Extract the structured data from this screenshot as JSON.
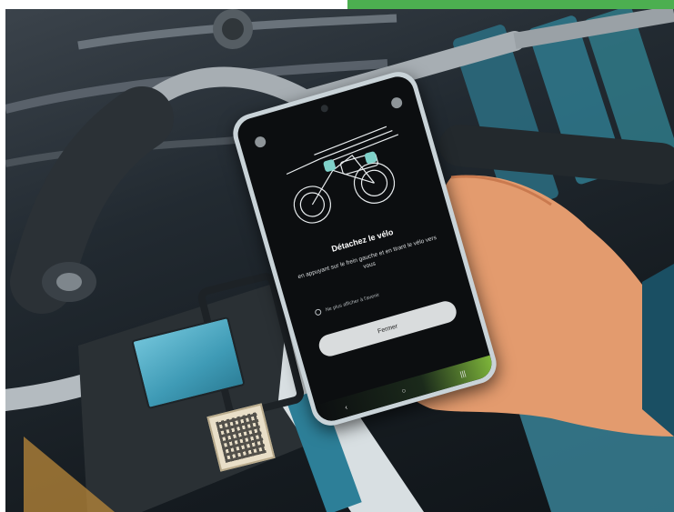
{
  "accent_colors": {
    "green_bar": "#4caf50",
    "station_teal": "#3f9bb6",
    "screen_background": "#0c0e10"
  },
  "phone_screen": {
    "title": "Détachez le vélo",
    "instructions": "en appuyant sur le frein gauche et en tirant le vélo vers vous",
    "checkbox_label": "Ne plus afficher à l'avenir",
    "close_button": "Fermer",
    "nav_icons": [
      "back-icon",
      "home-icon",
      "recents-icon"
    ]
  }
}
